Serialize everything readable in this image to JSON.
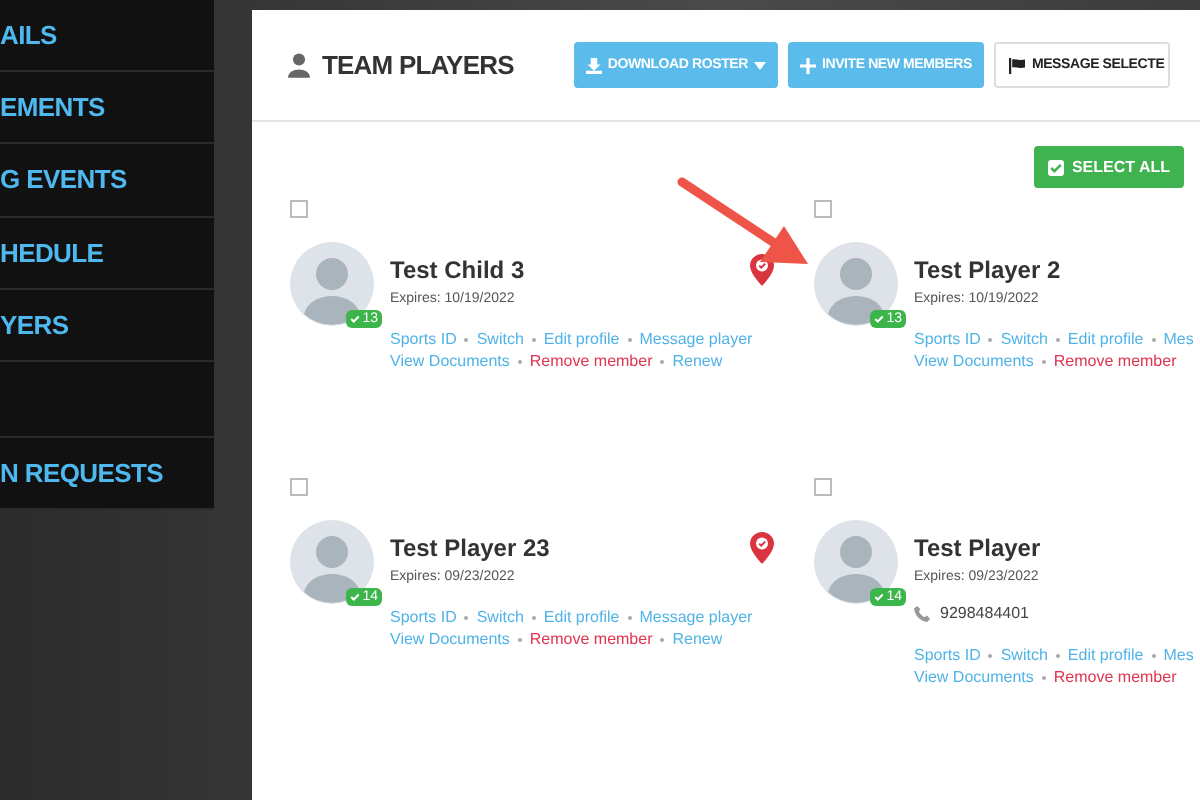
{
  "sidebar": {
    "items": [
      {
        "label": "AILS"
      },
      {
        "label": "EMENTS"
      },
      {
        "label": "G EVENTS"
      },
      {
        "label": "HEDULE"
      },
      {
        "label": "YERS"
      },
      {
        "label": "N REQUESTS"
      }
    ]
  },
  "header": {
    "title": "TEAM PLAYERS",
    "buttons": [
      {
        "label": "DOWNLOAD ROSTER",
        "kind": "download"
      },
      {
        "label": "INVITE NEW MEMBERS",
        "kind": "invite"
      },
      {
        "label": "MESSAGE SELECTE",
        "kind": "message"
      }
    ]
  },
  "select_all": {
    "label": "SELECT ALL"
  },
  "players": [
    {
      "name": "Test Child 3",
      "checked": false,
      "badge": "13",
      "expires": "Expires: 10/19/2022",
      "pin": true,
      "links": [
        [
          {
            "text": "Sports ID",
            "kind": "link"
          },
          {
            "text": "Switch",
            "kind": "link"
          },
          {
            "text": "Edit profile",
            "kind": "link"
          },
          {
            "text": "Message player",
            "kind": "link"
          }
        ],
        [
          {
            "text": "View Documents",
            "kind": "link"
          },
          {
            "text": "Remove member",
            "kind": "danger"
          },
          {
            "text": "Renew",
            "kind": "link"
          }
        ]
      ]
    },
    {
      "name": "Test Player 2",
      "checked": false,
      "badge": "13",
      "expires": "Expires: 10/19/2022",
      "pin": false,
      "links": [
        [
          {
            "text": "Sports ID",
            "kind": "link"
          },
          {
            "text": "Switch",
            "kind": "link"
          },
          {
            "text": "Edit profile",
            "kind": "link"
          },
          {
            "text": "Mes",
            "kind": "link"
          }
        ],
        [
          {
            "text": "View Documents",
            "kind": "link"
          },
          {
            "text": "Remove member",
            "kind": "danger"
          }
        ]
      ]
    },
    {
      "name": "Test Player 23",
      "checked": false,
      "badge": "14",
      "expires": "Expires: 09/23/2022",
      "pin": true,
      "links": [
        [
          {
            "text": "Sports ID",
            "kind": "link"
          },
          {
            "text": "Switch",
            "kind": "link"
          },
          {
            "text": "Edit profile",
            "kind": "link"
          },
          {
            "text": "Message player",
            "kind": "link"
          }
        ],
        [
          {
            "text": "View Documents",
            "kind": "link"
          },
          {
            "text": "Remove member",
            "kind": "danger"
          },
          {
            "text": "Renew",
            "kind": "link"
          }
        ]
      ]
    },
    {
      "name": "Test Player",
      "checked": false,
      "badge": "14",
      "expires": "Expires: 09/23/2022",
      "phone": "9298484401",
      "pin": false,
      "links": [
        [
          {
            "text": "Sports ID",
            "kind": "link"
          },
          {
            "text": "Switch",
            "kind": "link"
          },
          {
            "text": "Edit profile",
            "kind": "link"
          },
          {
            "text": "Mes",
            "kind": "link"
          }
        ],
        [
          {
            "text": "View Documents",
            "kind": "link"
          },
          {
            "text": "Remove member",
            "kind": "danger"
          }
        ]
      ]
    }
  ]
}
